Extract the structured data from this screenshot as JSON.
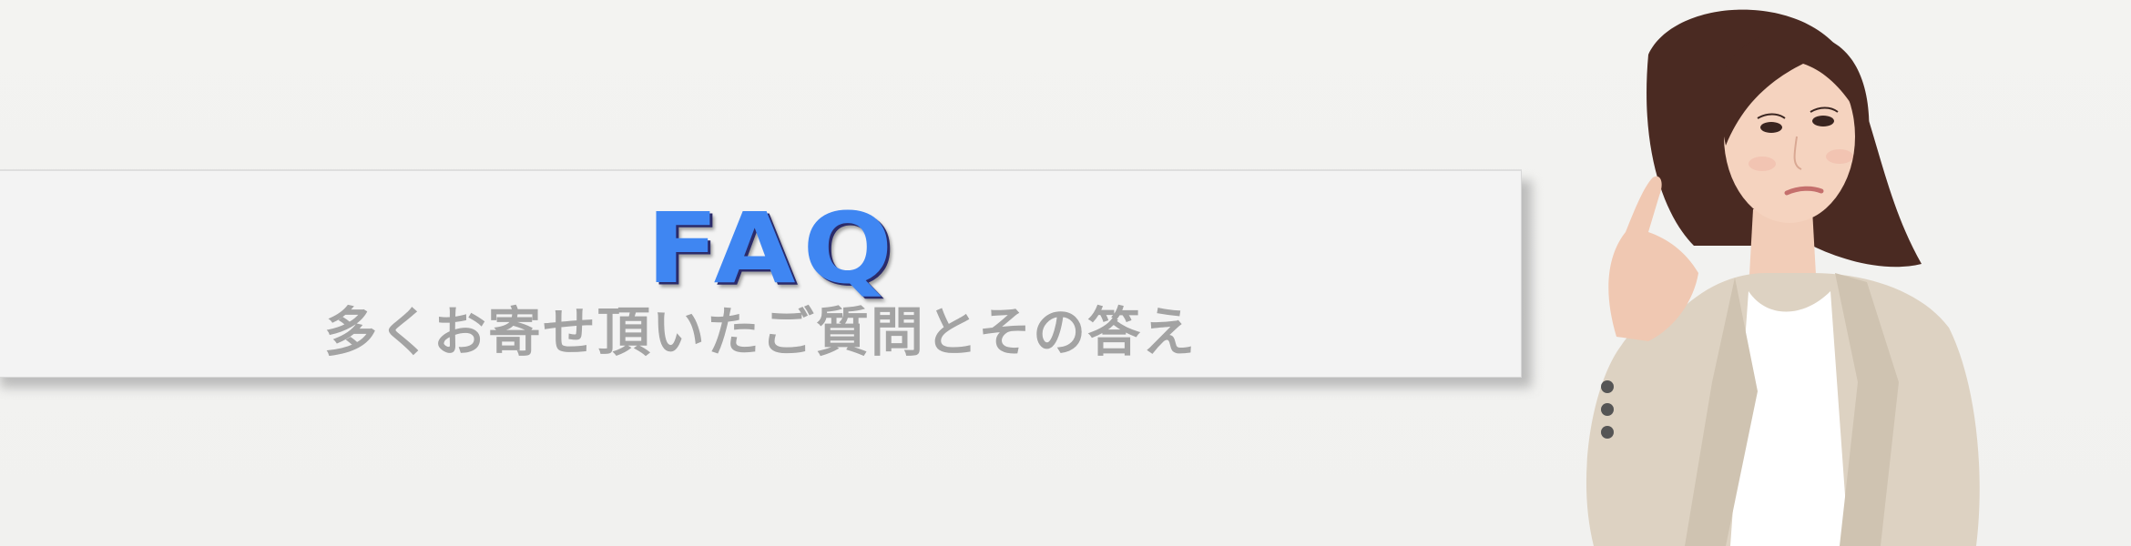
{
  "banner": {
    "title": "FAQ",
    "subtitle": "多くお寄せ頂いたご質問とその答え"
  },
  "colors": {
    "background": "#f2f2f0",
    "title_text": "#3f86f2",
    "subtitle_text": "#a3a3a3",
    "box": "#f3f3f3"
  },
  "image": {
    "subject": "woman-thinking-photo"
  }
}
